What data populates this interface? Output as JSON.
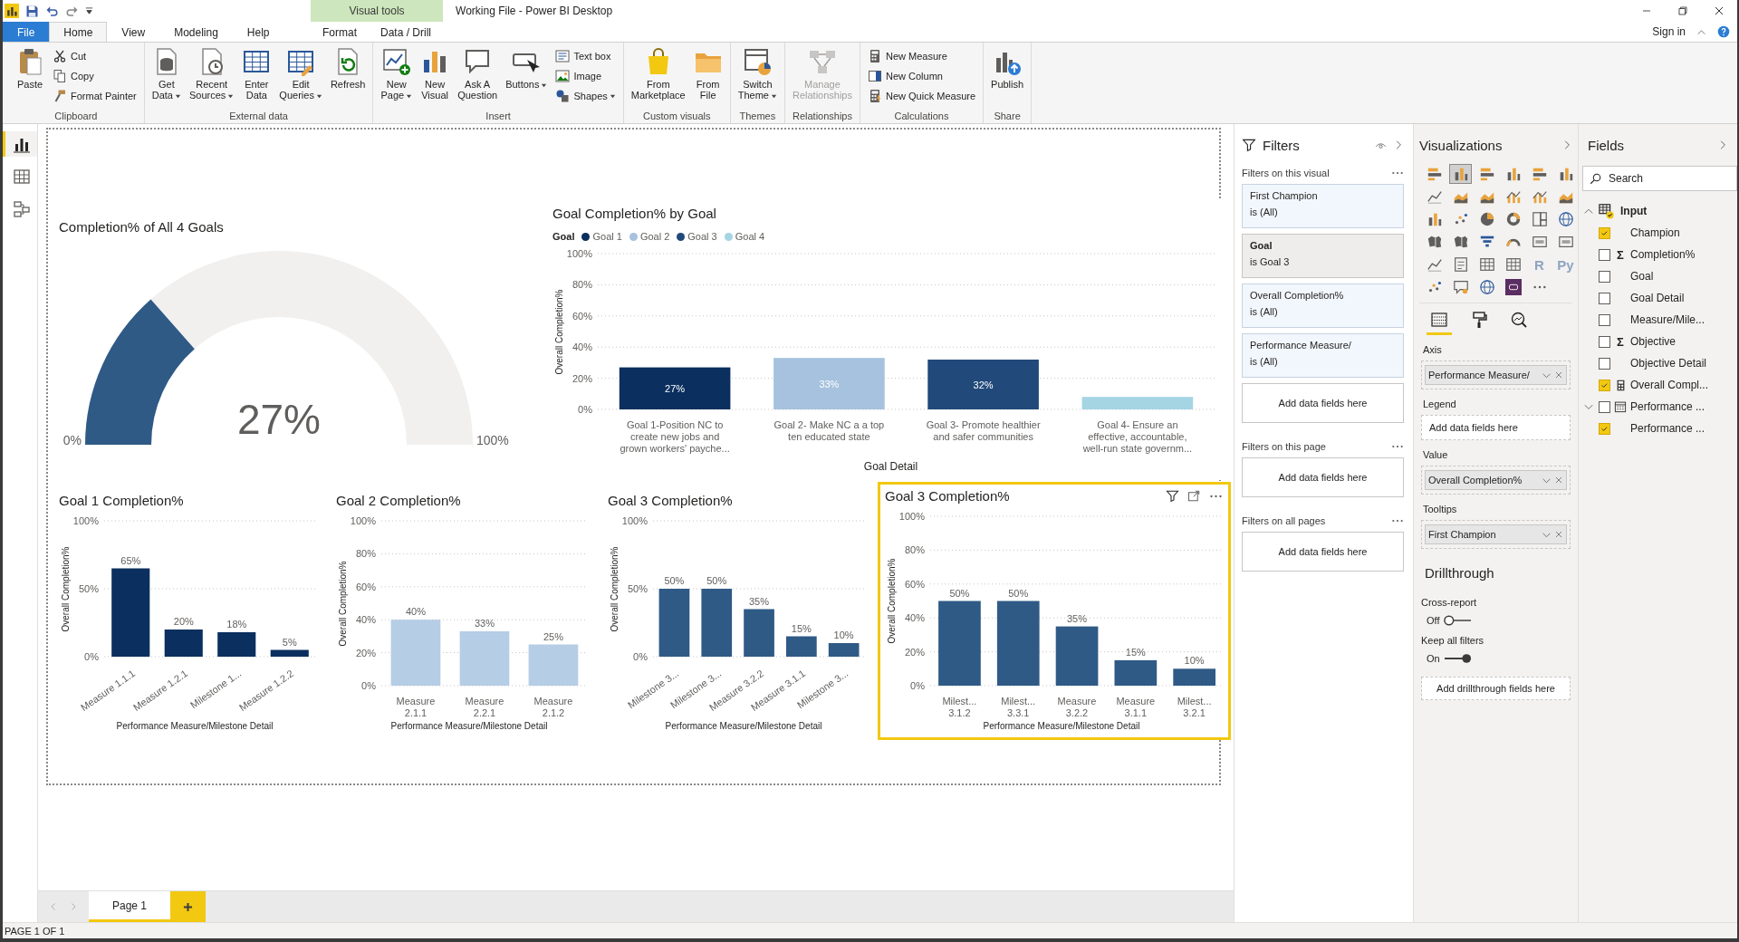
{
  "title_bar": {
    "title": "Working File - Power BI Desktop"
  },
  "ribbon_tabs": [
    {
      "label": "File",
      "kind": "file",
      "selected": false
    },
    {
      "label": "Home",
      "kind": "tab",
      "selected": true
    },
    {
      "label": "View",
      "kind": "tab",
      "selected": false
    },
    {
      "label": "Modeling",
      "kind": "tab",
      "selected": false
    },
    {
      "label": "Help",
      "kind": "tab",
      "selected": false
    }
  ],
  "contextual_tabs": {
    "label": "Visual tools",
    "tabs": [
      {
        "label": "Format",
        "selected": false
      },
      {
        "label": "Data / Drill",
        "selected": false
      }
    ]
  },
  "account": {
    "label": "Sign in"
  },
  "ribbon_groups": [
    {
      "label": "Clipboard",
      "items": [
        {
          "kind": "large",
          "label": "Paste",
          "dropdown": false,
          "disabled": false
        },
        {
          "kind": "small",
          "label": "Cut",
          "dropdown": false,
          "disabled": false
        },
        {
          "kind": "small",
          "label": "Copy",
          "dropdown": false,
          "disabled": false
        },
        {
          "kind": "small",
          "label": "Format Painter",
          "dropdown": false,
          "disabled": false
        }
      ]
    },
    {
      "label": "External data",
      "items": [
        {
          "kind": "large",
          "label": "Get\nData",
          "dropdown": true,
          "disabled": false
        },
        {
          "kind": "large",
          "label": "Recent\nSources",
          "dropdown": true,
          "disabled": false
        },
        {
          "kind": "large",
          "label": "Enter\nData",
          "dropdown": false,
          "disabled": false
        },
        {
          "kind": "large",
          "label": "Edit\nQueries",
          "dropdown": true,
          "disabled": false
        },
        {
          "kind": "large",
          "label": "Refresh",
          "dropdown": false,
          "disabled": false
        }
      ]
    },
    {
      "label": "Insert",
      "items": [
        {
          "kind": "large",
          "label": "New\nPage",
          "dropdown": true,
          "disabled": false
        },
        {
          "kind": "large",
          "label": "New\nVisual",
          "dropdown": false,
          "disabled": false
        },
        {
          "kind": "large",
          "label": "Ask A\nQuestion",
          "dropdown": false,
          "disabled": false
        },
        {
          "kind": "large",
          "label": "Buttons",
          "dropdown": true,
          "disabled": false
        },
        {
          "kind": "small",
          "label": "Text box",
          "dropdown": false,
          "disabled": false
        },
        {
          "kind": "small",
          "label": "Image",
          "dropdown": false,
          "disabled": false
        },
        {
          "kind": "small",
          "label": "Shapes",
          "dropdown": true,
          "disabled": false
        }
      ]
    },
    {
      "label": "Custom visuals",
      "items": [
        {
          "kind": "large",
          "label": "From\nMarketplace",
          "dropdown": false,
          "disabled": false
        },
        {
          "kind": "large",
          "label": "From\nFile",
          "dropdown": false,
          "disabled": false
        }
      ]
    },
    {
      "label": "Themes",
      "items": [
        {
          "kind": "large",
          "label": "Switch\nTheme",
          "dropdown": true,
          "disabled": false
        }
      ]
    },
    {
      "label": "Relationships",
      "items": [
        {
          "kind": "large",
          "label": "Manage\nRelationships",
          "dropdown": false,
          "disabled": true
        }
      ]
    },
    {
      "label": "Calculations",
      "items": [
        {
          "kind": "small",
          "label": "New Measure",
          "dropdown": false,
          "disabled": false
        },
        {
          "kind": "small",
          "label": "New Column",
          "dropdown": false,
          "disabled": false
        },
        {
          "kind": "small",
          "label": "New Quick Measure",
          "dropdown": false,
          "disabled": false
        }
      ]
    },
    {
      "label": "Share",
      "items": [
        {
          "kind": "large",
          "label": "Publish",
          "dropdown": false,
          "disabled": false
        }
      ]
    }
  ],
  "view_bar": [
    {
      "selected": true
    },
    {
      "selected": false
    },
    {
      "selected": false
    }
  ],
  "visuals": [
    {
      "kind": "gauge",
      "selected": false,
      "title": "Completion% of All 4 Goals",
      "value": "27%",
      "min": "0%",
      "max": "100%",
      "level": 0.27
    },
    {
      "kind": "bar",
      "selected": false,
      "chart_data": {
        "type": "bar",
        "grid": true,
        "legend": {
          "title": "Goal"
        },
        "title": "Goal Completion% by Goal",
        "xlabel": "Goal Detail",
        "ylabel": "Overall Completion%",
        "categories": [
          "Goal 1-Position NC to create new jobs and grown workers' payche...",
          "Goal 2- Make NC a a top ten educated state",
          "Goal 3- Promote healthier and safer communities",
          "Goal 4- Ensure an effective, accountable, well-run state governm..."
        ],
        "stacked": true,
        "ylim": [
          0,
          100
        ],
        "yticks": [
          {
            "value": 0,
            "label": "0%"
          },
          {
            "value": 20,
            "label": "20%"
          },
          {
            "value": 40,
            "label": "40%"
          },
          {
            "value": 60,
            "label": "60%"
          },
          {
            "value": 80,
            "label": "80%"
          },
          {
            "value": 100,
            "label": "100%"
          }
        ],
        "series": [
          {
            "name": "Goal 1",
            "color": "#0b2f5e",
            "values": [
              27,
              null,
              null,
              null
            ],
            "value_labels": [
              "27%",
              null,
              null,
              null
            ]
          },
          {
            "name": "Goal 2",
            "color": "#a6c2de",
            "values": [
              null,
              33,
              null,
              null
            ],
            "value_labels": [
              null,
              "33%",
              null,
              null
            ]
          },
          {
            "name": "Goal 3",
            "color": "#21497a",
            "values": [
              null,
              null,
              32,
              null
            ],
            "value_labels": [
              null,
              null,
              "32%",
              null
            ]
          },
          {
            "name": "Goal 4",
            "color": "#a5d4e3",
            "values": [
              null,
              null,
              null,
              8
            ],
            "value_labels": [
              null,
              null,
              null,
              null
            ]
          }
        ]
      }
    },
    {
      "kind": "bar",
      "selected": false,
      "chart_data": {
        "type": "bar",
        "grid": true,
        "title": "Goal 1 Completion%",
        "xlabel": "Performance Measure/Milestone Detail",
        "ylabel": "Overall Completion%",
        "categories": [
          "Measure 1.1.1",
          "Measure 1.2.1",
          "Milestone 1...",
          "Measure 1.2.2"
        ],
        "ylim": [
          0,
          100
        ],
        "yticks": [
          {
            "value": 0,
            "label": "0%"
          },
          {
            "value": 50,
            "label": "50%"
          },
          {
            "value": 100,
            "label": "100%"
          }
        ],
        "series": [
          {
            "color": "#0b2f5e",
            "values": [
              65,
              20,
              18,
              5
            ],
            "value_labels": [
              "65%",
              "20%",
              "18%",
              "5%"
            ]
          }
        ]
      }
    },
    {
      "kind": "bar",
      "selected": false,
      "chart_data": {
        "type": "bar",
        "grid": true,
        "title": "Goal 2 Completion%",
        "xlabel": "Performance Measure/Milestone Detail",
        "ylabel": "Overall Completion%",
        "categories": [
          "Measure 2.1.1",
          "Measure 2.2.1",
          "Measure 2.1.2"
        ],
        "ylim": [
          0,
          100
        ],
        "yticks": [
          {
            "value": 0,
            "label": "0%"
          },
          {
            "value": 20,
            "label": "20%"
          },
          {
            "value": 40,
            "label": "40%"
          },
          {
            "value": 60,
            "label": "60%"
          },
          {
            "value": 80,
            "label": "80%"
          },
          {
            "value": 100,
            "label": "100%"
          }
        ],
        "series": [
          {
            "color": "#b5cde5",
            "values": [
              40,
              33,
              25
            ],
            "value_labels": [
              "40%",
              "33%",
              "25%"
            ]
          }
        ]
      }
    },
    {
      "kind": "bar",
      "selected": false,
      "chart_data": {
        "type": "bar",
        "grid": true,
        "title": "Goal 3 Completion%",
        "xlabel": "Performance Measure/Milestone Detail",
        "ylabel": "Overall Completion%",
        "categories": [
          "Milestone 3...",
          "Milestone 3...",
          "Measure 3.2.2",
          "Measure 3.1.1",
          "Milestone 3..."
        ],
        "ylim": [
          0,
          100
        ],
        "yticks": [
          {
            "value": 0,
            "label": "0%"
          },
          {
            "value": 50,
            "label": "50%"
          },
          {
            "value": 100,
            "label": "100%"
          }
        ],
        "series": [
          {
            "color": "#2f5a86",
            "values": [
              50,
              50,
              35,
              15,
              10
            ],
            "value_labels": [
              "50%",
              "50%",
              "35%",
              "15%",
              "10%"
            ]
          }
        ]
      }
    },
    {
      "kind": "bar",
      "selected": true,
      "chart_data": {
        "type": "bar",
        "grid": true,
        "title": "Goal 3 Completion%",
        "xlabel": "Performance Measure/Milestone Detail",
        "ylabel": "Overall Completion%",
        "categories": [
          "Milest... 3.1.2",
          "Milest... 3.3.1",
          "Measure 3.2.2",
          "Measure 3.1.1",
          "Milest... 3.2.1"
        ],
        "ylim": [
          0,
          100
        ],
        "yticks": [
          {
            "value": 0,
            "label": "0%"
          },
          {
            "value": 20,
            "label": "20%"
          },
          {
            "value": 40,
            "label": "40%"
          },
          {
            "value": 60,
            "label": "60%"
          },
          {
            "value": 80,
            "label": "80%"
          },
          {
            "value": 100,
            "label": "100%"
          }
        ],
        "series": [
          {
            "color": "#2f5a86",
            "values": [
              50,
              50,
              35,
              15,
              10
            ],
            "value_labels": [
              "50%",
              "50%",
              "35%",
              "15%",
              "10%"
            ]
          }
        ]
      }
    }
  ],
  "filters": {
    "title": "Filters",
    "sections": [
      {
        "label": "Filters on this visual",
        "cards": [
          {
            "field": "First Champion",
            "condition": "is (All)",
            "applied": false
          },
          {
            "field": "Goal",
            "condition": "is Goal 3",
            "applied": true
          },
          {
            "field": "Overall Completion%",
            "condition": "is (All)",
            "applied": false
          },
          {
            "field": "Performance Measure/",
            "condition": "is (All)",
            "applied": false
          }
        ],
        "drop_zone": "Add data fields here"
      },
      {
        "label": "Filters on this page",
        "drop_zone": "Add data fields here"
      },
      {
        "label": "Filters on all pages",
        "drop_zone": "Add data fields here"
      }
    ]
  },
  "visualizations": {
    "title": "Visualizations",
    "types": [
      {
        "selected": false
      },
      {
        "selected": true
      },
      {
        "selected": false
      },
      {
        "selected": false
      },
      {
        "selected": false
      },
      {
        "selected": false
      },
      {
        "selected": false
      },
      {
        "selected": false
      },
      {
        "selected": false
      },
      {
        "selected": false
      },
      {
        "selected": false
      },
      {
        "selected": false
      },
      {
        "selected": false
      },
      {
        "selected": false
      },
      {
        "selected": false
      },
      {
        "selected": false
      },
      {
        "selected": false
      },
      {
        "selected": false
      },
      {
        "selected": false
      },
      {
        "selected": false
      },
      {
        "selected": false
      },
      {
        "selected": false
      },
      {
        "selected": false
      },
      {
        "selected": false
      },
      {
        "selected": false
      },
      {
        "selected": false
      },
      {
        "selected": false
      },
      {
        "selected": false
      },
      {
        "selected": false,
        "label": "R"
      },
      {
        "selected": false,
        "label": "Py"
      },
      {
        "selected": false
      },
      {
        "selected": false
      },
      {
        "selected": false
      },
      {
        "selected": false
      },
      {
        "selected": false
      }
    ],
    "pane_tabs": [
      {
        "selected": true
      },
      {
        "selected": false
      },
      {
        "selected": false
      }
    ],
    "wells": [
      {
        "label": "Axis",
        "field": "Performance Measure/"
      },
      {
        "label": "Legend",
        "drop_zone": "Add data fields here"
      },
      {
        "label": "Value",
        "field": "Overall Completion%"
      },
      {
        "label": "Tooltips",
        "field": "First Champion"
      }
    ],
    "drillthrough": {
      "title": "Drillthrough",
      "toggles": [
        {
          "label": "Cross-report",
          "state": "Off",
          "on": false
        },
        {
          "label": "Keep all filters",
          "state": "On",
          "on": true
        }
      ],
      "drop_zone": "Add drillthrough fields here"
    }
  },
  "fields": {
    "title": "Fields",
    "search": {
      "placeholder": "Search"
    },
    "tree": [
      {
        "label": "Input",
        "kind": "table",
        "expanded": true,
        "checked": true,
        "children": [
          {
            "label": "Champion",
            "kind": "field",
            "checked": true
          },
          {
            "label": "Completion%",
            "kind": "sum",
            "symbol": "Σ",
            "checked": false
          },
          {
            "label": "Goal",
            "kind": "field",
            "checked": false
          },
          {
            "label": "Goal Detail",
            "kind": "field",
            "checked": false
          },
          {
            "label": "Measure/Mile...",
            "kind": "field",
            "checked": false
          },
          {
            "label": "Objective",
            "kind": "sum",
            "symbol": "Σ",
            "checked": false
          },
          {
            "label": "Objective Detail",
            "kind": "field",
            "checked": false
          },
          {
            "label": "Overall Compl...",
            "kind": "measure",
            "checked": true
          },
          {
            "label": "Performance ...",
            "kind": "hierarchy",
            "expanded": true,
            "checked": false,
            "children": [
              {
                "label": "Performance ...",
                "kind": "field",
                "checked": true
              }
            ]
          }
        ]
      }
    ]
  },
  "pages": [
    {
      "label": "Page 1",
      "selected": true
    }
  ],
  "status_bar": {
    "text": "PAGE 1 OF 1"
  }
}
